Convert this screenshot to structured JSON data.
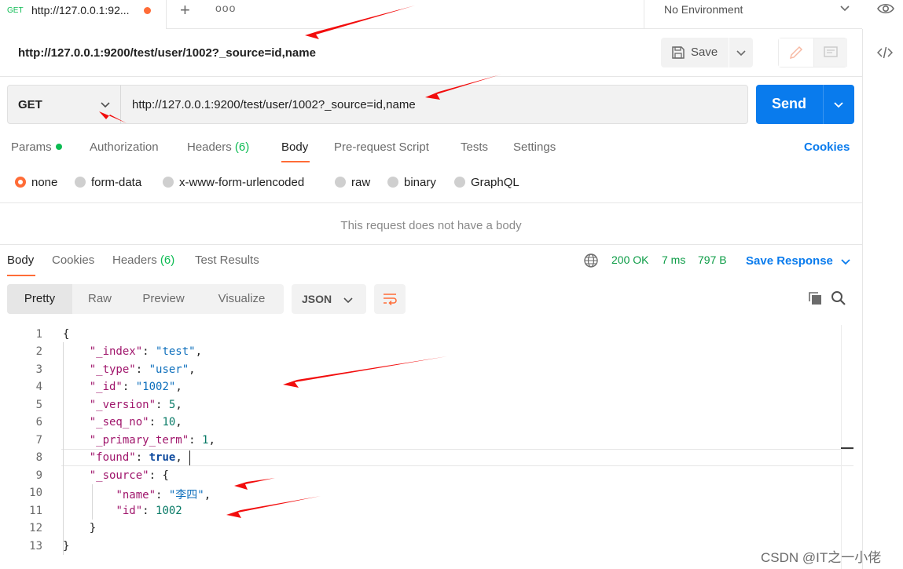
{
  "tab": {
    "method": "GET",
    "title": "http://127.0.0.1:92...",
    "unsaved": true
  },
  "toolbar": {
    "new_tab": "+",
    "more": "ooo"
  },
  "environment": {
    "label": "No Environment"
  },
  "request": {
    "title": "http://127.0.0.1:9200/test/user/1002?_source=id,name",
    "save_label": "Save",
    "method": "GET",
    "url": "http://127.0.0.1:9200/test/user/1002?_source=id,name",
    "send_label": "Send"
  },
  "request_tabs": {
    "params": "Params",
    "authorization": "Authorization",
    "headers": "Headers",
    "headers_count": "(6)",
    "body": "Body",
    "prerequest": "Pre-request Script",
    "tests": "Tests",
    "settings": "Settings",
    "cookies": "Cookies"
  },
  "body_types": {
    "none": "none",
    "form_data": "form-data",
    "urlencoded": "x-www-form-urlencoded",
    "raw": "raw",
    "binary": "binary",
    "graphql": "GraphQL",
    "selected": "none"
  },
  "no_body_message": "This request does not have a body",
  "response_tabs": {
    "body": "Body",
    "cookies": "Cookies",
    "headers": "Headers",
    "headers_count": "(6)",
    "test_results": "Test Results"
  },
  "response_status": {
    "status": "200 OK",
    "time": "7 ms",
    "size": "797 B",
    "save_response": "Save Response"
  },
  "view_modes": {
    "pretty": "Pretty",
    "raw": "Raw",
    "preview": "Preview",
    "visualize": "Visualize",
    "active": "Pretty"
  },
  "format": "JSON",
  "code": {
    "line_numbers": [
      "1",
      "2",
      "3",
      "4",
      "5",
      "6",
      "7",
      "8",
      "9",
      "10",
      "11",
      "12",
      "13"
    ],
    "l1": "{",
    "l2_key": "\"_index\"",
    "l2_val": "\"test\"",
    "l3_key": "\"_type\"",
    "l3_val": "\"user\"",
    "l4_key": "\"_id\"",
    "l4_val": "\"1002\"",
    "l5_key": "\"_version\"",
    "l5_val": "5",
    "l6_key": "\"_seq_no\"",
    "l6_val": "10",
    "l7_key": "\"_primary_term\"",
    "l7_val": "1",
    "l8_key": "\"found\"",
    "l8_val": "true",
    "l9_key": "\"_source\"",
    "l9_val": "{",
    "l10_key": "\"name\"",
    "l10_val": "\"李四\"",
    "l11_key": "\"id\"",
    "l11_val": "1002",
    "l12": "}",
    "l13": "}"
  },
  "watermark": "CSDN @IT之一小佬",
  "colors": {
    "accent": "#ff6c37",
    "send": "#097bed",
    "status_ok": "#0c9c46",
    "annotation": "#f20d0d"
  }
}
